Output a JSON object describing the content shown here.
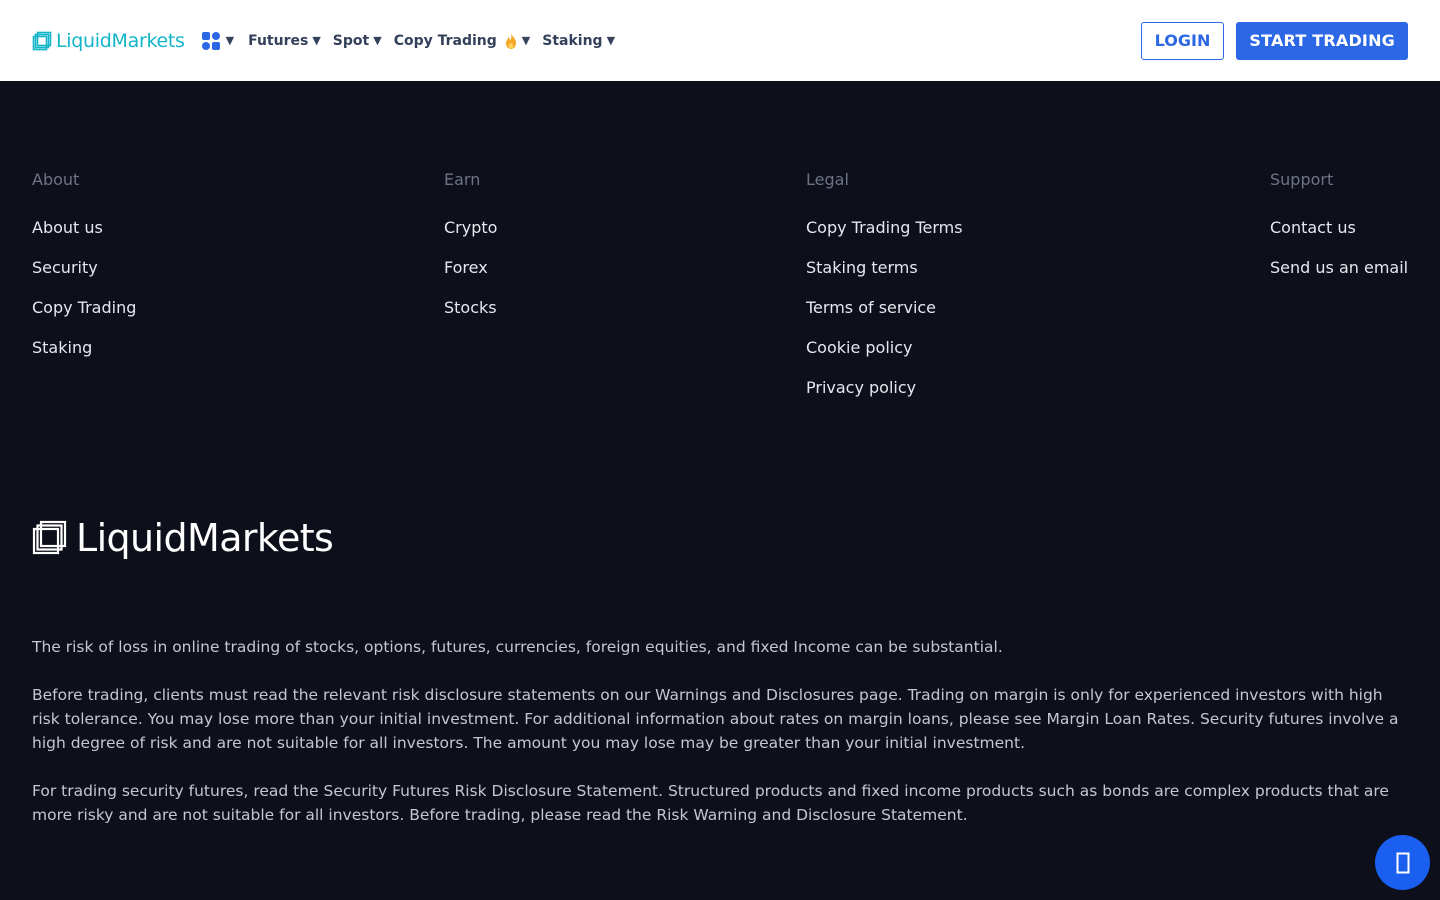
{
  "header": {
    "logo_text": "LiquidMarkets",
    "nav": [
      {
        "label": "Futures"
      },
      {
        "label": "Spot"
      },
      {
        "label": "Copy Trading"
      },
      {
        "label": "Staking"
      }
    ],
    "login_label": "LOGIN",
    "start_label": "START TRADING"
  },
  "footer": {
    "columns": [
      {
        "title": "About",
        "links": [
          "About us",
          "Security",
          "Copy Trading",
          "Staking"
        ]
      },
      {
        "title": "Earn",
        "links": [
          "Crypto",
          "Forex",
          "Stocks"
        ]
      },
      {
        "title": "Legal",
        "links": [
          "Copy Trading Terms",
          "Staking terms",
          "Terms of service",
          "Cookie policy",
          "Privacy policy"
        ]
      },
      {
        "title": "Support",
        "links": [
          "Contact us",
          "Send us an email"
        ]
      }
    ],
    "brand_text": "LiquidMarkets",
    "disclaimer": [
      "The risk of loss in online trading of stocks, options, futures, currencies, foreign equities, and fixed Income can be substantial.",
      "Before trading, clients must read the relevant risk disclosure statements on our Warnings and Disclosures page. Trading on margin is only for experienced investors with high risk tolerance. You may lose more than your initial investment. For additional information about rates on margin loans, please see Margin Loan Rates. Security futures involve a high degree of risk and are not suitable for all investors. The amount you may lose may be greater than your initial investment.",
      "For trading security futures, read the Security Futures Risk Disclosure Statement. Structured products and fixed income products such as bonds are complex products that are more risky and are not suitable for all investors. Before trading, please read the Risk Warning and Disclosure Statement."
    ]
  },
  "colors": {
    "accent": "#2c67e6",
    "brand_teal": "#13b5c9",
    "background": "#0d0f1a"
  },
  "icons": {
    "logo": "stacked-squares-icon",
    "apps": "apps-grid-icon",
    "flame": "flame-icon",
    "chat": "chat-icon"
  }
}
